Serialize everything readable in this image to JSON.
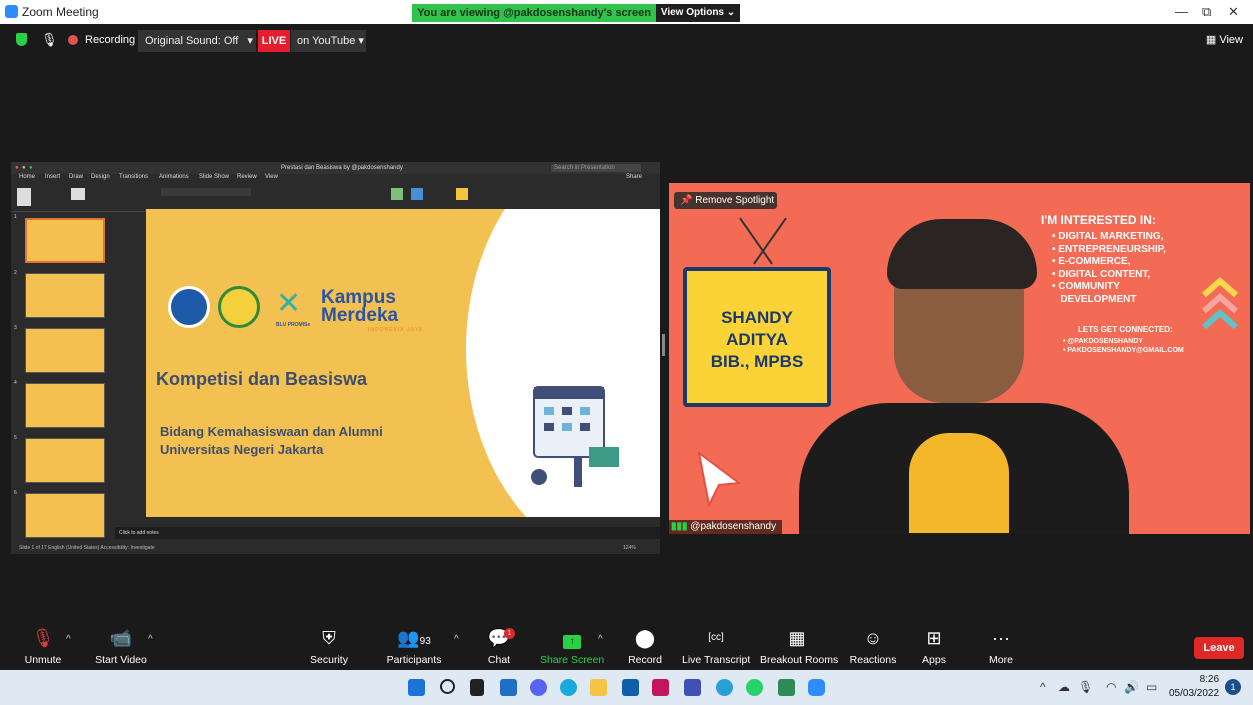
{
  "window": {
    "title": "Zoom Meeting",
    "viewing_banner": "You are viewing @pakdosenshandy's screen",
    "view_options": "View Options ⌄"
  },
  "meeting_topbar": {
    "recording": "Recording",
    "original_sound": "Original Sound: Off",
    "live": "LIVE",
    "youtube": "on YouTube ▾",
    "view": "View"
  },
  "shared_screen": {
    "ppt_title": "Prestasi dan Beasiswa by @pakdosenshandy",
    "search_placeholder": "Search in Presentation",
    "share_label": "Share",
    "tabs": [
      "Home",
      "Insert",
      "Draw",
      "Design",
      "Transitions",
      "Animations",
      "Slide Show",
      "Review",
      "View"
    ],
    "slide": {
      "logo_text": "Kampus Merdeka",
      "logo_tagline": "INDONESIA JAYA",
      "blu_label": "BLU PROMISe",
      "title": "Kompetisi dan Beasiswa",
      "subtitle_line1": "Bidang Kemahasiswaan dan Alumni",
      "subtitle_line2": "Universitas Negeri Jakarta"
    },
    "thumbnail_numbers": [
      "1",
      "2",
      "3",
      "4",
      "5",
      "6"
    ],
    "notes_placeholder": "Click to add notes",
    "status": "Slide 1 of 17    English (United States)    Accessibility: Investigate",
    "zoom_level": "124%"
  },
  "speaker": {
    "remove_spotlight": "Remove Spotlight",
    "name_sign": [
      "SHANDY",
      "ADITYA",
      "BIB., MPBS"
    ],
    "interests_title": "I'M INTERESTED IN:",
    "interests": [
      "• DIGITAL MARKETING,",
      "• ENTREPRENEURSHIP,",
      "• E-COMMERCE,",
      "• DIGITAL CONTENT,",
      "• COMMUNITY",
      "   DEVELOPMENT"
    ],
    "connect_title": "LETS GET CONNECTED:",
    "connect": [
      "• @PAKDOSENSHANDY",
      "• PAKDOSENSHANDY@GMAIL.COM"
    ],
    "name_tag": "@pakdosenshandy"
  },
  "controls": {
    "unmute": "Unmute",
    "start_video": "Start Video",
    "security": "Security",
    "participants": "Participants",
    "participants_count": "93",
    "chat": "Chat",
    "chat_badge": "1",
    "share_screen": "Share Screen",
    "record": "Record",
    "live_transcript": "Live Transcript",
    "breakout_rooms": "Breakout Rooms",
    "reactions": "Reactions",
    "apps": "Apps",
    "more": "More",
    "leave": "Leave"
  },
  "taskbar": {
    "time": "8:26",
    "date": "05/03/2022",
    "notification_count": "1"
  },
  "colors": {
    "zoom_blue": "#2d8cff",
    "banner_green": "#31c24d",
    "live_red": "#e41e2e",
    "slide_yellow": "#f3c052",
    "speaker_bg": "#f36b55",
    "leave_red": "#e02828"
  }
}
